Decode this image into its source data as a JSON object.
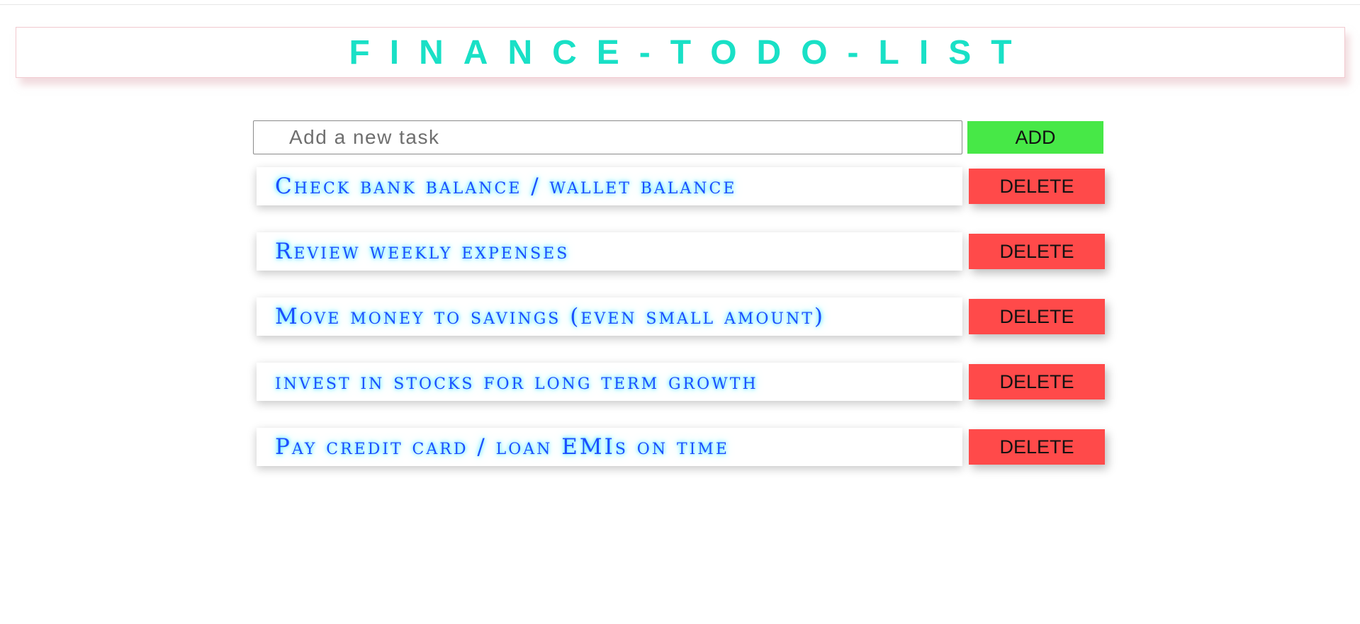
{
  "header": {
    "title": "FINANCE-TODO-LIST",
    "title_color": "#19e0c6"
  },
  "add_task": {
    "placeholder": "Add a new task",
    "value": "",
    "button_label": "ADD",
    "button_color": "#47e847"
  },
  "tasks": [
    {
      "text": "Check bank balance / wallet balance",
      "delete_label": "DELETE"
    },
    {
      "text": "Review weekly expenses",
      "delete_label": "DELETE"
    },
    {
      "text": "Move money to savings (even small amount)",
      "delete_label": "DELETE"
    },
    {
      "text": "invest in stocks for long term growth",
      "delete_label": "DELETE"
    },
    {
      "text": "Pay credit card / loan EMIs on time",
      "delete_label": "DELETE"
    }
  ],
  "colors": {
    "task_text": "#1c4dff",
    "task_glow": "#2fe3ff",
    "delete_button": "#ff4a4a"
  }
}
